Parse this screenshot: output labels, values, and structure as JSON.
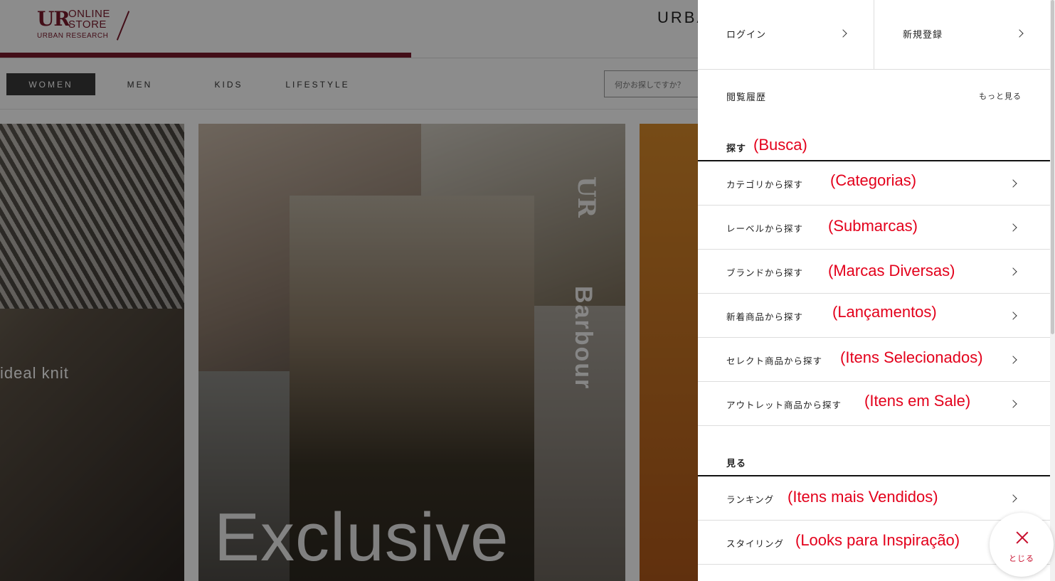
{
  "header": {
    "logo_ur": "UR",
    "logo_line1": "ONLINE",
    "logo_line2": "STORE",
    "logo_sub": "URBAN RESEARCH",
    "brand_partial": "URBA"
  },
  "nav": {
    "tabs": [
      {
        "label": "WOMEN",
        "active": true
      },
      {
        "label": "MEN",
        "active": false
      },
      {
        "label": "KIDS",
        "active": false
      },
      {
        "label": "LIFESTYLE",
        "active": false
      }
    ],
    "search_placeholder": "何かお探しですか？"
  },
  "banners": {
    "b1_text": "ideal knit",
    "b2_brand": "Barbour",
    "b2_ur": "UR",
    "b2_headline": "Exclusive"
  },
  "drawer": {
    "login": "ログイン",
    "register": "新規登録",
    "history": "閲覧履歴",
    "more": "もっと見る",
    "search_section": {
      "title": "探す",
      "annotation": "(Busca)",
      "items": [
        {
          "label": "カテゴリから探す",
          "annotation": "(Categorias)"
        },
        {
          "label": "レーベルから探す",
          "annotation": "(Submarcas)"
        },
        {
          "label": "ブランドから探す",
          "annotation": "(Marcas Diversas)"
        },
        {
          "label": "新着商品から探す",
          "annotation": "(Lançamentos)"
        },
        {
          "label": "セレクト商品から探す",
          "annotation": "(Itens Selecionados)"
        },
        {
          "label": "アウトレット商品から探す",
          "annotation": "(Itens em Sale)"
        }
      ]
    },
    "view_section": {
      "title": "見る",
      "items": [
        {
          "label": "ランキング",
          "annotation": "(Itens mais Vendidos)"
        },
        {
          "label": "スタイリング",
          "annotation": "(Looks para Inspiração)"
        }
      ]
    },
    "close_label": "とじる"
  },
  "colors": {
    "brand": "#7a1a2c",
    "annotation": "#e3001b",
    "close_accent": "#c8102e"
  }
}
